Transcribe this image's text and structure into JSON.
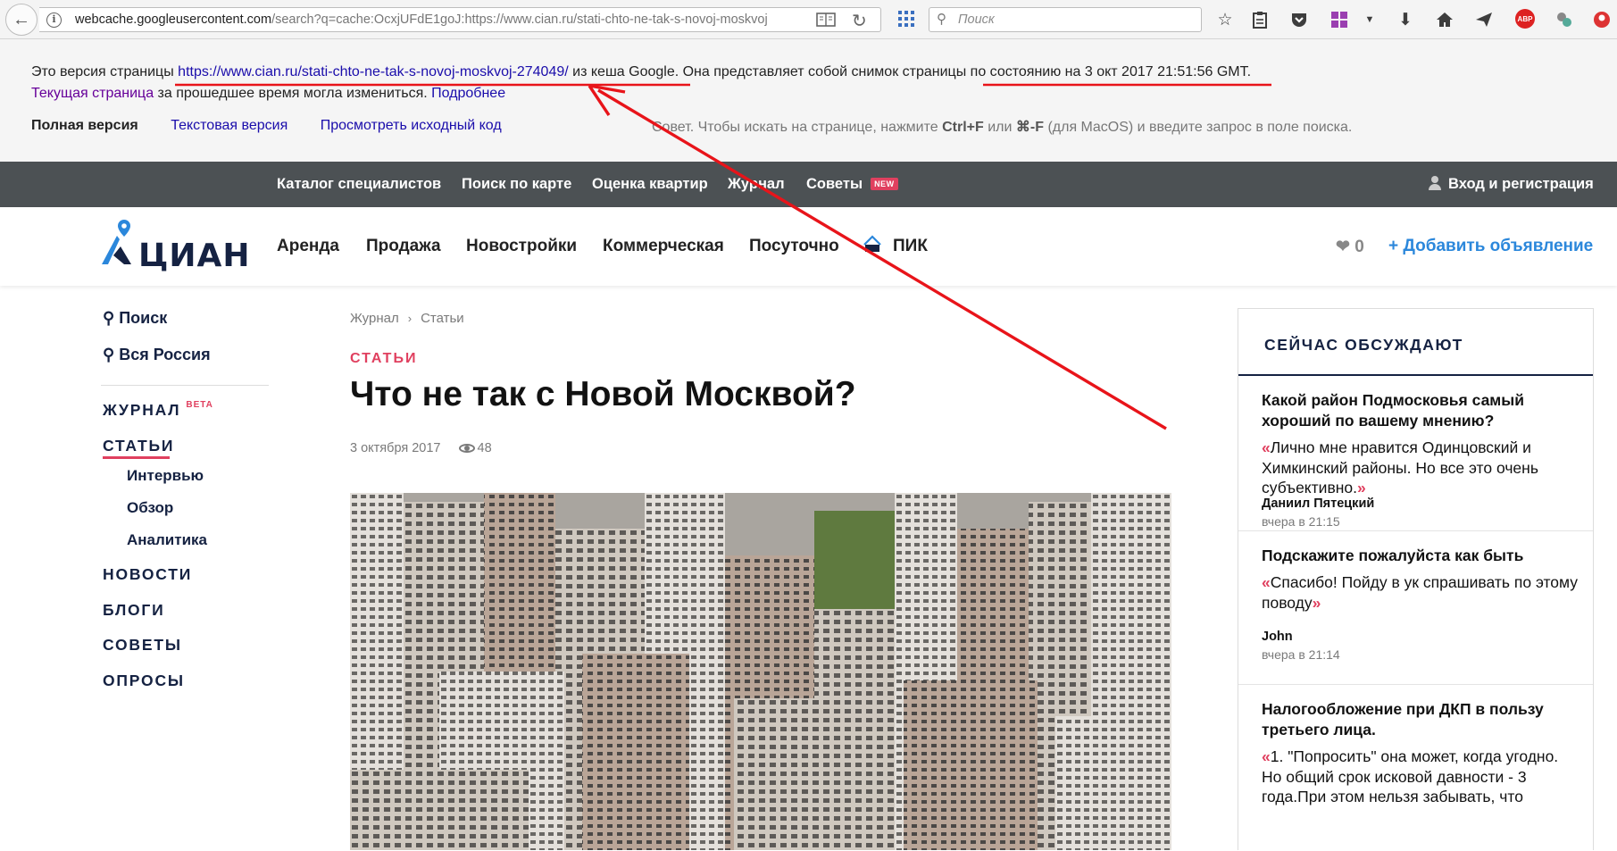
{
  "browser": {
    "url_host": "webcache.googleusercontent.com",
    "url_rest": "/search?q=cache:OcxjUFdE1goJ:https://www.cian.ru/stati-chto-ne-tak-s-novoj-moskvoj",
    "search_placeholder": "Поиск"
  },
  "cache_notice": {
    "prefix": "Это версия страницы",
    "page_url": "https://www.cian.ru/stati-chto-ne-tak-s-novoj-moskvoj-274049/",
    "from_cache": "из кеша Google.",
    "snapshot_text": "Она представляет собой снимок страницы",
    "snapshot_date": "по состоянию на 3 окт 2017 21:51:56 GMT.",
    "current_page_link": "Текущая страница",
    "changed_text": "за прошедшее время могла измениться.",
    "more_link": "Подробнее",
    "full_version": "Полная версия",
    "text_version": "Текстовая версия",
    "view_source": "Просмотреть исходный код",
    "tip_prefix": "Совет. Чтобы искать на странице, нажмите",
    "tip_key1": "Ctrl+F",
    "tip_or": "или",
    "tip_key2": "⌘-F",
    "tip_suffix": "(для MacOS) и введите запрос в поле поиска."
  },
  "top_nav": {
    "items": [
      "Каталог специалистов",
      "Поиск по карте",
      "Оценка квартир",
      "Журнал",
      "Советы"
    ],
    "new_badge": "NEW",
    "login": "Вход и регистрация"
  },
  "main_nav": {
    "logo": "ЦИАН",
    "items": [
      "Аренда",
      "Продажа",
      "Новостройки",
      "Коммерческая",
      "Посуточно",
      "ПИК"
    ],
    "favorites_count": "0",
    "add_listing": "+ Добавить объявление"
  },
  "left_nav": {
    "search": "Поиск",
    "region": "Вся Россия",
    "journal": "ЖУРНАЛ",
    "beta": "BETA",
    "sections": [
      "СТАТЬИ",
      "НОВОСТИ",
      "БЛОГИ",
      "СОВЕТЫ",
      "ОПРОСЫ"
    ],
    "subsections": [
      "Интервью",
      "Обзор",
      "Аналитика"
    ]
  },
  "article": {
    "breadcrumb": [
      "Журнал",
      "Статьи"
    ],
    "category": "СТАТЬИ",
    "title": "Что не так с Новой Москвой?",
    "date": "3 октября 2017",
    "views": "48"
  },
  "sidebar": {
    "title": "СЕЙЧАС ОБСУЖДАЮТ",
    "items": [
      {
        "question": "Какой район Подмосковья самый хороший по вашему мнению?",
        "comment": "Лично мне нравится Одинцовский и Химкинский районы. Но все это очень субъективно.",
        "author": "Даниил Пятецкий",
        "time": "вчера в 21:15"
      },
      {
        "question": "Подскажите пожалуйста как быть",
        "comment": "Спасибо! Пойду в ук спрашивать по этому поводу",
        "author": "John",
        "time": "вчера в 21:14"
      },
      {
        "question": "Налогообложение при ДКП в пользу третьего лица.",
        "comment": "1. \"Попросить\" она может, когда угодно. Но общий срок исковой давности - 3 года.При этом нельзя забывать, что",
        "author": "",
        "time": ""
      }
    ]
  },
  "colors": {
    "accent_red": "#e0405f",
    "brand_navy": "#152242",
    "link_blue": "#2b87db",
    "topnav_bg": "#4c5154",
    "annotation_red": "#e8141a"
  },
  "icons": [
    "back-arrow-icon",
    "info-icon",
    "reader-icon",
    "reload-icon",
    "apps-icon",
    "search-icon",
    "star-icon",
    "clipboard-icon",
    "pocket-icon",
    "extensions-icon",
    "download-icon",
    "home-icon",
    "send-icon",
    "adblock-icon",
    "user-icon",
    "heart-icon",
    "location-pin-icon",
    "eye-icon"
  ]
}
